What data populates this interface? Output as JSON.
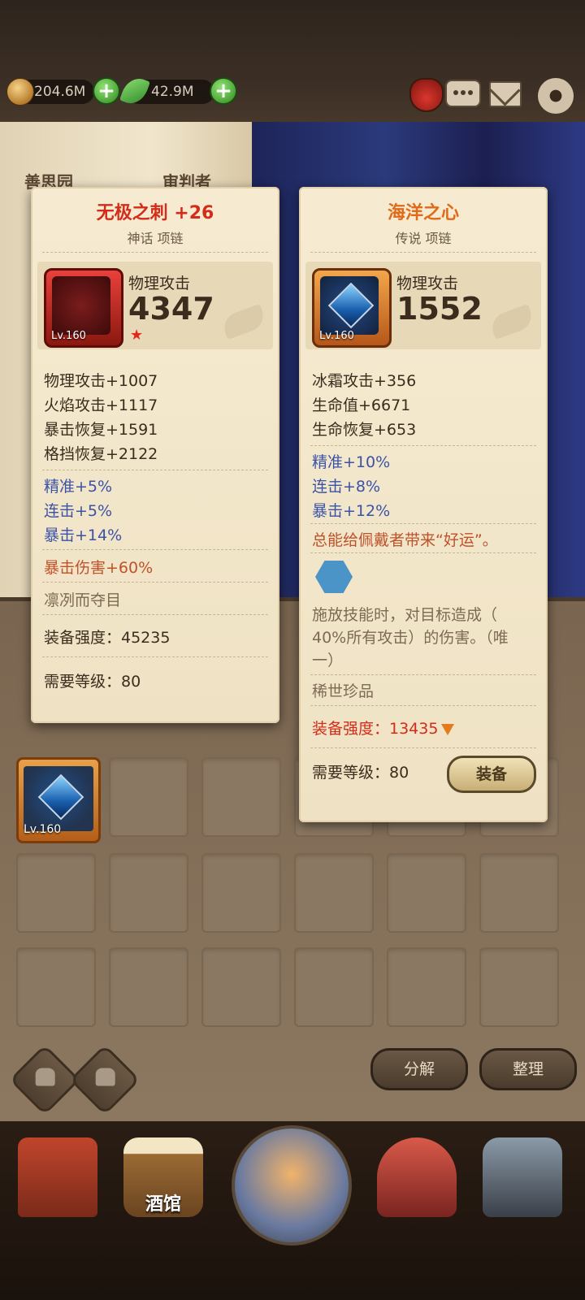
{
  "hud": {
    "gold": "204.6M",
    "gems": "42.9M",
    "icons": [
      "coin-icon",
      "leaf-icon",
      "plus-icon",
      "bag-icon",
      "chat-icon",
      "mail-icon",
      "gear-icon"
    ]
  },
  "backdrop": {
    "book_left_title": "善思园",
    "book_right_title": "审判者"
  },
  "card_left": {
    "title": "无极之刺 +26",
    "subtitle": "神话 项链",
    "level": "Lv.160",
    "main_stat_name": "物理攻击",
    "main_stat_value": "4347",
    "stats": [
      "物理攻击+1007",
      "火焰攻击+1117",
      "暴击恢复+1591",
      "格挡恢复+2122"
    ],
    "blue_stats": [
      "精准+5%",
      "连击+5%",
      "暴击+14%"
    ],
    "special": "暴击伤害+60%",
    "flavor": "凛冽而夺目",
    "power_label": "装备强度：45235",
    "req_label": "需要等级：80",
    "title_color": "#d42c1a"
  },
  "card_right": {
    "title": "海洋之心",
    "subtitle": "传说 项链",
    "level": "Lv.160",
    "main_stat_name": "物理攻击",
    "main_stat_value": "1552",
    "stats": [
      "冰霜攻击+356",
      "生命值+6671",
      "生命恢复+653"
    ],
    "blue_stats": [
      "精准+10%",
      "连击+8%",
      "暴击+12%"
    ],
    "special": "总能给佩戴者带来“好运”。",
    "skill_desc_1": "施放技能时，对目标造成（",
    "skill_desc_2": "40%所有攻击）的伤害。（唯",
    "skill_desc_3": "一）",
    "rarity_note": "稀世珍品",
    "power_label": "装备强度：13435",
    "req_label": "需要等级：80",
    "equip_button": "装备",
    "title_color": "#e06a1a"
  },
  "inventory": {
    "first_item_level": "Lv.160"
  },
  "actions": {
    "decompose": "分解",
    "sort": "整理"
  },
  "nav": {
    "tavern": "酒馆"
  }
}
